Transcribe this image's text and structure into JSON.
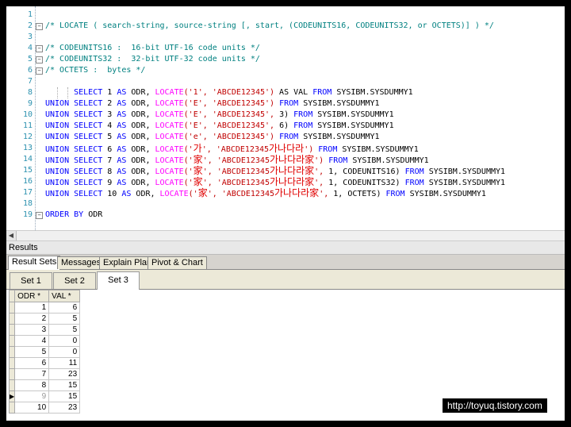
{
  "editor": {
    "line_numbers": [
      "1",
      "2",
      "3",
      "4",
      "5",
      "6",
      "7",
      "8",
      "9",
      "10",
      "11",
      "12",
      "13",
      "14",
      "15",
      "16",
      "17",
      "18",
      "19"
    ],
    "comments": {
      "l2": "/* LOCATE ( search-string, source-string [, start, (CODEUNITS16, CODEUNITS32, or OCTETS)] ) */",
      "l4": "/* CODEUNITS16 :  16-bit UTF-16 code units */",
      "l5": "/* CODEUNITS32 :  32-bit UTF-32 code units */",
      "l6": "/* OCTETS :  bytes */"
    },
    "kw": {
      "select": "SELECT",
      "union": "UNION",
      "as": "AS",
      "from": "FROM",
      "locate": "LOCATE",
      "order_by": "ORDER BY"
    },
    "lines": [
      {
        "lead": "",
        "num": "1",
        "rest_pre": " ODR, ",
        "args": "('1', 'ABCDE12345')",
        "tail": " AS VAL ",
        "table": " SYSIBM.SYSDUMMY1"
      },
      {
        "lead": "UNION",
        "num": "2",
        "rest_pre": " ODR, ",
        "args": "('E', 'ABCDE12345')",
        "tail": " ",
        "table": " SYSIBM.SYSDUMMY1"
      },
      {
        "lead": "UNION",
        "num": "3",
        "rest_pre": " ODR, ",
        "args": "('E', 'ABCDE12345',",
        "tail": " 3) ",
        "table": " SYSIBM.SYSDUMMY1"
      },
      {
        "lead": "UNION",
        "num": "4",
        "rest_pre": " ODR, ",
        "args": "('E', 'ABCDE12345',",
        "tail": " 6) ",
        "table": " SYSIBM.SYSDUMMY1"
      },
      {
        "lead": "UNION",
        "num": "5",
        "rest_pre": " ODR, ",
        "args": "('e', 'ABCDE12345')",
        "tail": " ",
        "table": " SYSIBM.SYSDUMMY1"
      }
    ],
    "korean": {
      "ga": "가",
      "ga_str": "가나다라",
      "ka": "家",
      "ka_str": "가나다라家"
    },
    "order_col": "ODR",
    "units": {
      "cu16": "CODEUNITS16",
      "cu32": "CODEUNITS32",
      "oct": "OCTETS"
    }
  },
  "results": {
    "title": "Results",
    "tabs": [
      "Result Sets",
      "Messages",
      "Explain Plan",
      "Pivot & Chart"
    ],
    "active_tab": "Result Sets",
    "sets": [
      "Set 1",
      "Set 2",
      "Set 3"
    ],
    "active_set": "Set 3",
    "columns": [
      "ODR *",
      "VAL *"
    ],
    "rows": [
      {
        "odr": "1",
        "val": "6"
      },
      {
        "odr": "2",
        "val": "5"
      },
      {
        "odr": "3",
        "val": "5"
      },
      {
        "odr": "4",
        "val": "0"
      },
      {
        "odr": "5",
        "val": "0"
      },
      {
        "odr": "6",
        "val": "11"
      },
      {
        "odr": "7",
        "val": "23"
      },
      {
        "odr": "8",
        "val": "15"
      },
      {
        "odr": "9",
        "val": "15"
      },
      {
        "odr": "10",
        "val": "23"
      }
    ],
    "current_row_marker": "▶"
  },
  "watermark": "http://toyuq.tistory.com"
}
